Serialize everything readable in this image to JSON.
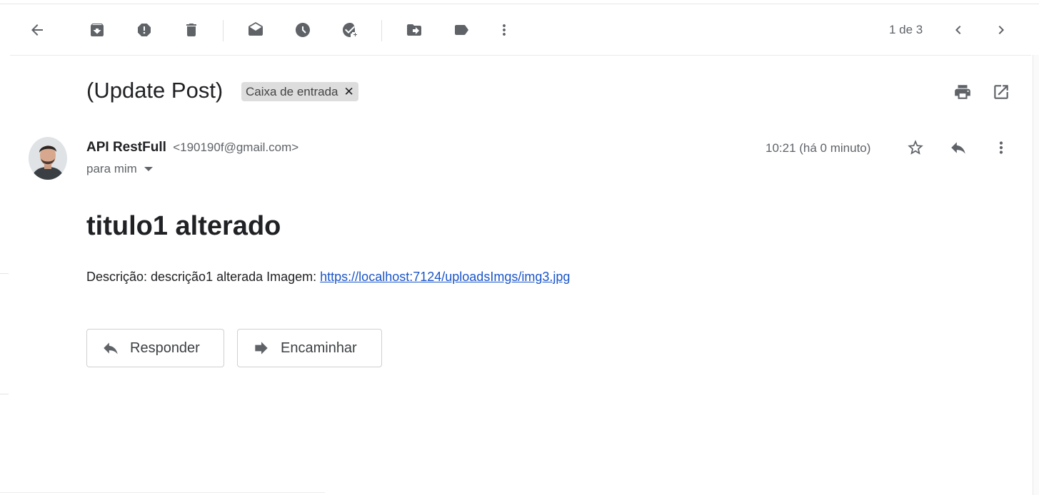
{
  "toolbar": {
    "icons": [
      "back-arrow-icon",
      "archive-icon",
      "report-spam-icon",
      "delete-icon",
      "mark-unread-icon",
      "snooze-icon",
      "add-to-tasks-icon",
      "move-to-icon",
      "labels-icon",
      "more-vert-icon"
    ],
    "pager": "1 de 3"
  },
  "message": {
    "subject": "(Update Post)",
    "label": "Caixa de entrada",
    "sender_name": "API RestFull",
    "sender_email": "<190190f@gmail.com>",
    "to": "para mim",
    "time": "10:21 (há 0 minuto)",
    "headline": "titulo1 alterado",
    "description_prefix": "Descrição: descrição1 alterada Imagem: ",
    "link": "https://localhost:7124/uploadsImgs/img3.jpg"
  },
  "actions": {
    "reply": "Responder",
    "forward": "Encaminhar"
  },
  "colors": {
    "link": "#1a55c9",
    "icon": "#5f6368",
    "chip": "#dddddd"
  }
}
